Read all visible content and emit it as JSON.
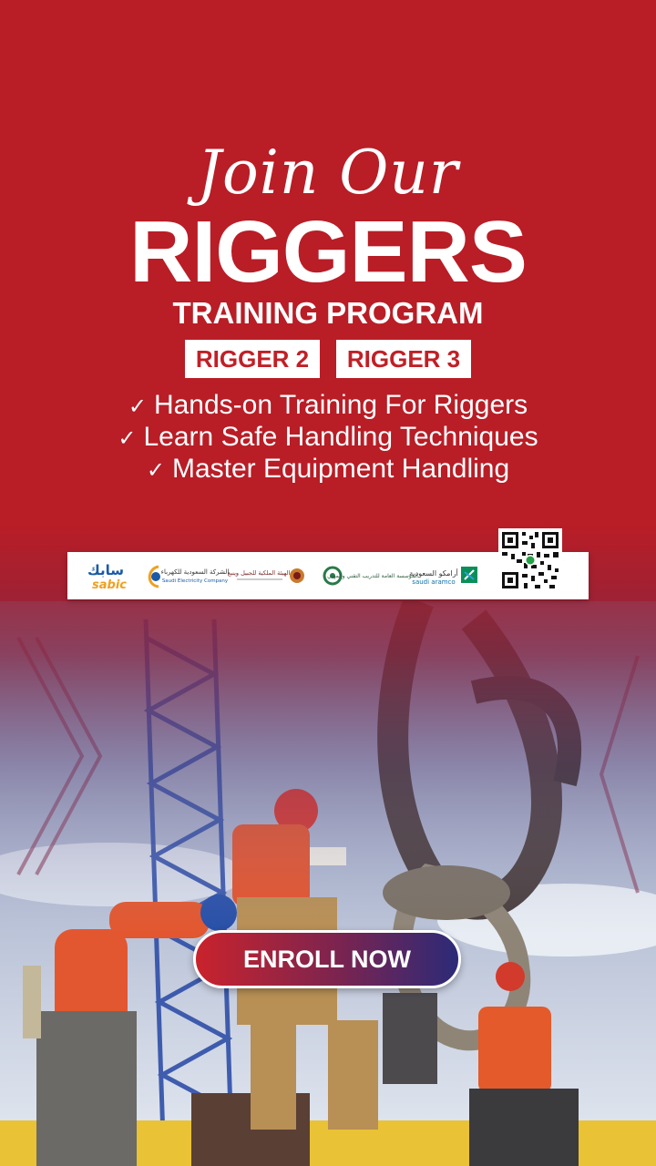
{
  "hero": {
    "script_title": "Join Our",
    "title": "RIGGERS",
    "subtitle": "TRAINING PROGRAM"
  },
  "levels": [
    "RIGGER 2",
    "RIGGER 3"
  ],
  "features": [
    "Hands-on Training For Riggers",
    "Learn Safe Handling Techniques",
    "Master Equipment Handling"
  ],
  "partners": {
    "sabic_arabic": "سابك",
    "sabic": "sabic",
    "sec_arabic": "الشركة السعودية للكهرباء",
    "sec": "Saudi Electricity Company",
    "royal_commission": "الهيئة الملكية للجبيل وينبع",
    "tvtc": "المؤسسة العامة للتدريب التقني والمهني",
    "aramco_arabic": "أرامكو السعودية",
    "aramco": "saudi aramco"
  },
  "cta": {
    "label": "ENROLL NOW"
  },
  "colors": {
    "brand_red": "#c21f26",
    "cta_gradient_end": "#2c2a78",
    "text_light": "#ffffff"
  },
  "icons": {
    "check": "check-icon",
    "qr": "qr-code-icon"
  }
}
